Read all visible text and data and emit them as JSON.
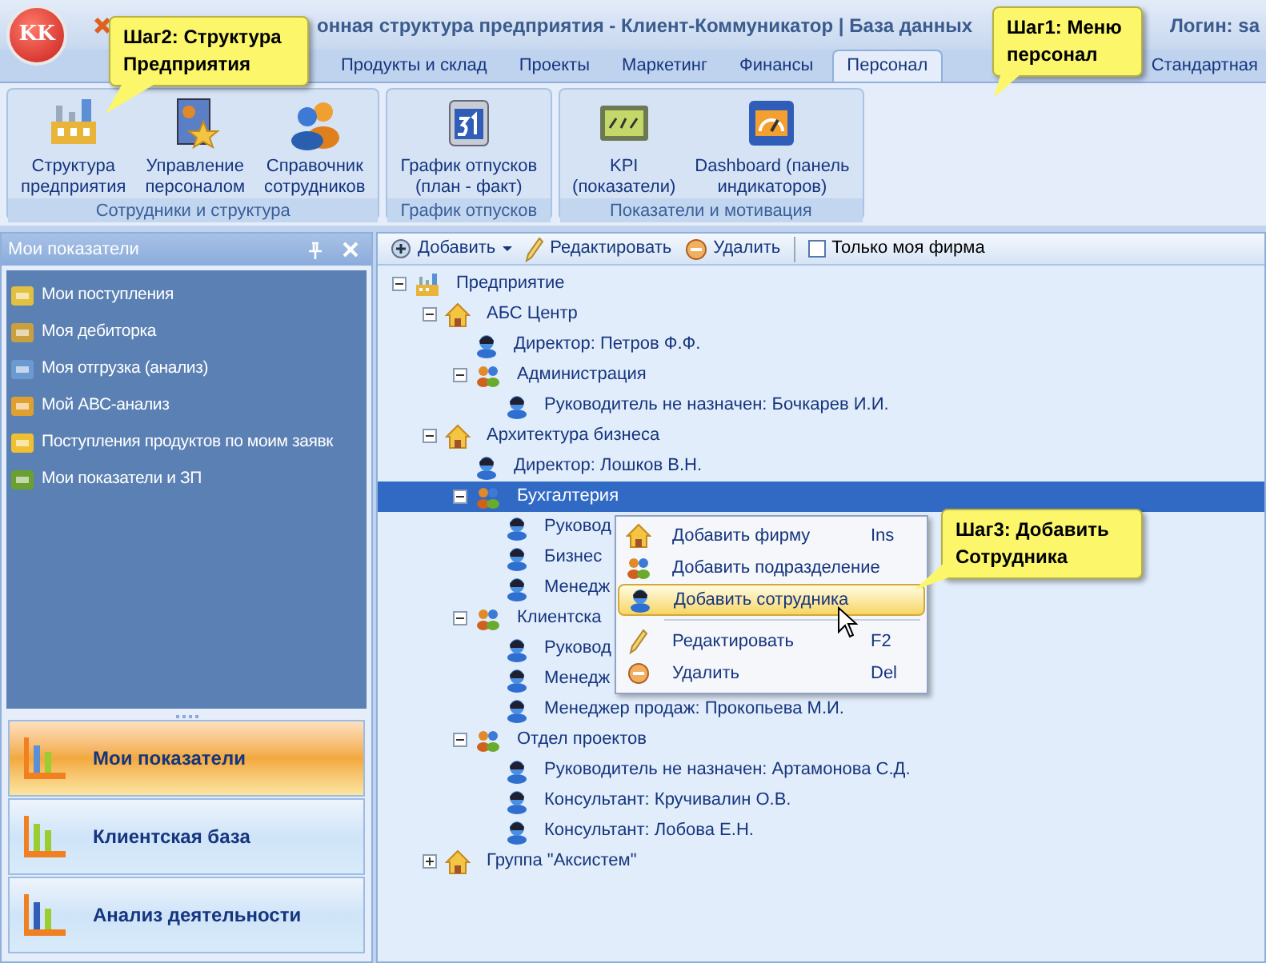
{
  "window": {
    "logo": "KK",
    "title_start": "онная структура предприятия - Клиент-Коммуникатор | База данных",
    "title_end": "Логин: sa"
  },
  "tabs": [
    {
      "label": "Продукты и склад",
      "selected": false
    },
    {
      "label": "Проекты",
      "selected": false
    },
    {
      "label": "Маркетинг",
      "selected": false
    },
    {
      "label": "Финансы",
      "selected": false
    },
    {
      "label": "Персонал",
      "selected": true
    },
    {
      "label": "Стандартная",
      "selected": false
    }
  ],
  "ribbon_groups": [
    {
      "title": "Сотрудники и структура",
      "buttons": [
        {
          "label": "Структура\nпредприятия",
          "kind": "factory"
        },
        {
          "label": "Управление\nперсоналом",
          "kind": "manage"
        },
        {
          "label": "Справочник\nсотрудников",
          "kind": "people"
        }
      ]
    },
    {
      "title": "График отпусков",
      "buttons": [
        {
          "label": "График отпусков\n(план - факт)",
          "kind": "calendar"
        }
      ]
    },
    {
      "title": "Показатели и мотивация",
      "buttons": [
        {
          "label": "KPI\n(показатели)",
          "kind": "kpi"
        },
        {
          "label": "Dashboard (панель\nиндикаторов)",
          "kind": "dashboard"
        }
      ]
    }
  ],
  "left_panel": {
    "title": "Мои показатели",
    "items": [
      "Мои поступления",
      "Моя дебиторка",
      "Моя отгрузка (анализ)",
      "Мой АВС-анализ",
      "Поступления продуктов по моим заявк",
      "Мои показатели и ЗП"
    ],
    "nav": [
      {
        "label": "Мои показатели",
        "selected": true
      },
      {
        "label": "Клиентская база",
        "selected": false
      },
      {
        "label": "Анализ деятельности",
        "selected": false
      }
    ]
  },
  "toolbar": {
    "add": "Добавить",
    "edit": "Редактировать",
    "delete": "Удалить",
    "only_my_firm": {
      "label": "Только моя фирма",
      "checked": false
    }
  },
  "tree": [
    {
      "label": "Предприятие",
      "kind": "root",
      "expanded": true,
      "selected": false,
      "children": [
        {
          "label": "АБС Центр",
          "kind": "company",
          "expanded": true,
          "selected": false,
          "children": [
            {
              "label": "Директор: Петров Ф.Ф.",
              "kind": "person",
              "selected": false
            },
            {
              "label": "Администрация",
              "kind": "department",
              "expanded": true,
              "selected": false,
              "children": [
                {
                  "label": "Руководитель не назначен: Бочкарев И.И.",
                  "kind": "person",
                  "selected": false
                }
              ]
            }
          ]
        },
        {
          "label": "Архитектура бизнеса",
          "kind": "company",
          "expanded": true,
          "selected": false,
          "children": [
            {
              "label": "Директор: Лошков В.Н.",
              "kind": "person",
              "selected": false
            },
            {
              "label": "Бухгалтерия",
              "kind": "department",
              "expanded": true,
              "selected": true,
              "children": [
                {
                  "label": "Руковод",
                  "kind": "person",
                  "selected": false
                },
                {
                  "label": "Бизнес",
                  "kind": "person",
                  "selected": false
                },
                {
                  "label": "Менедж",
                  "kind": "person",
                  "selected": false
                }
              ]
            },
            {
              "label": "Клиентска",
              "kind": "department",
              "expanded": true,
              "selected": false,
              "children": [
                {
                  "label": "Руковод",
                  "kind": "person",
                  "selected": false
                },
                {
                  "label": "Менедж",
                  "kind": "person",
                  "selected": false
                },
                {
                  "label": "Менеджер продаж: Прокопьева М.И.",
                  "kind": "person",
                  "selected": false
                }
              ]
            },
            {
              "label": "Отдел проектов",
              "kind": "department",
              "expanded": true,
              "selected": false,
              "children": [
                {
                  "label": "Руководитель не назначен: Артамонова С.Д.",
                  "kind": "person",
                  "selected": false
                },
                {
                  "label": "Консультант: Кручивалин О.В.",
                  "kind": "person",
                  "selected": false
                },
                {
                  "label": "Консультант: Лобова Е.Н.",
                  "kind": "person",
                  "selected": false
                }
              ]
            }
          ]
        },
        {
          "label": "Группа \"Аксистем\"",
          "kind": "company",
          "expanded": false,
          "selected": false
        }
      ]
    }
  ],
  "context_menu": [
    {
      "kind": "company",
      "label": "Добавить фирму",
      "shortcut": "Ins",
      "selected": false
    },
    {
      "kind": "department",
      "label": "Добавить подразделение",
      "selected": false
    },
    {
      "kind": "person",
      "label": "Добавить сотрудника",
      "selected": true
    },
    {
      "kind": "separator"
    },
    {
      "kind": "edit",
      "label": "Редактировать",
      "shortcut": "F2",
      "selected": false
    },
    {
      "kind": "delete",
      "label": "Удалить",
      "shortcut": "Del",
      "selected": false
    }
  ],
  "callouts": [
    "Шаг2: Структура Предприятия",
    "Шаг1: Меню персонал",
    "Шаг3: Добавить Сотрудника"
  ]
}
